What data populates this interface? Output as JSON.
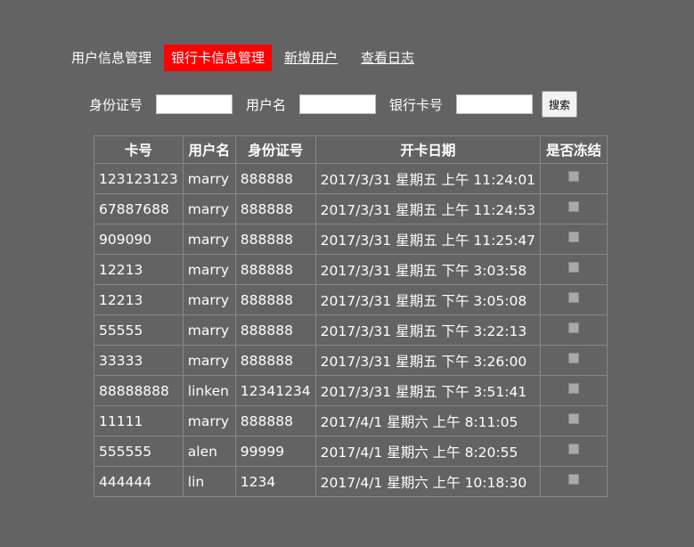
{
  "nav": {
    "user_info": "用户信息管理",
    "bank_card_info": "银行卡信息管理",
    "add_user": "新增用户",
    "view_logs": "查看日志"
  },
  "search": {
    "id_label": "身份证号",
    "username_label": "用户名",
    "card_label": "银行卡号",
    "button_label": "搜索",
    "id_value": "",
    "username_value": "",
    "card_value": ""
  },
  "table": {
    "headers": [
      "卡号",
      "用户名",
      "身份证号",
      "开卡日期",
      "是否冻结"
    ],
    "rows": [
      [
        "123123123",
        "marry",
        "888888",
        "2017/3/31 星期五 上午 11:24:01"
      ],
      [
        "67887688",
        "marry",
        "888888",
        "2017/3/31 星期五 上午 11:24:53"
      ],
      [
        "909090",
        "marry",
        "888888",
        "2017/3/31 星期五 上午 11:25:47"
      ],
      [
        "12213",
        "marry",
        "888888",
        "2017/3/31 星期五 下午 3:03:58"
      ],
      [
        "12213",
        "marry",
        "888888",
        "2017/3/31 星期五 下午 3:05:08"
      ],
      [
        "55555",
        "marry",
        "888888",
        "2017/3/31 星期五 下午 3:22:13"
      ],
      [
        "33333",
        "marry",
        "888888",
        "2017/3/31 星期五 下午 3:26:00"
      ],
      [
        "88888888",
        "linken",
        "12341234",
        "2017/3/31 星期五 下午 3:51:41"
      ],
      [
        "11111",
        "marry",
        "888888",
        "2017/4/1 星期六 上午 8:11:05"
      ],
      [
        "555555",
        "alen",
        "99999",
        "2017/4/1 星期六 上午 8:20:55"
      ],
      [
        "444444",
        "lin",
        "1234",
        "2017/4/1 星期六 上午 10:18:30"
      ]
    ],
    "frozen": [
      false,
      false,
      false,
      false,
      false,
      false,
      false,
      false,
      false,
      false,
      false
    ]
  },
  "colors": {
    "background": "#636363",
    "active_tab": "#ff0000",
    "text": "#ffffff"
  }
}
